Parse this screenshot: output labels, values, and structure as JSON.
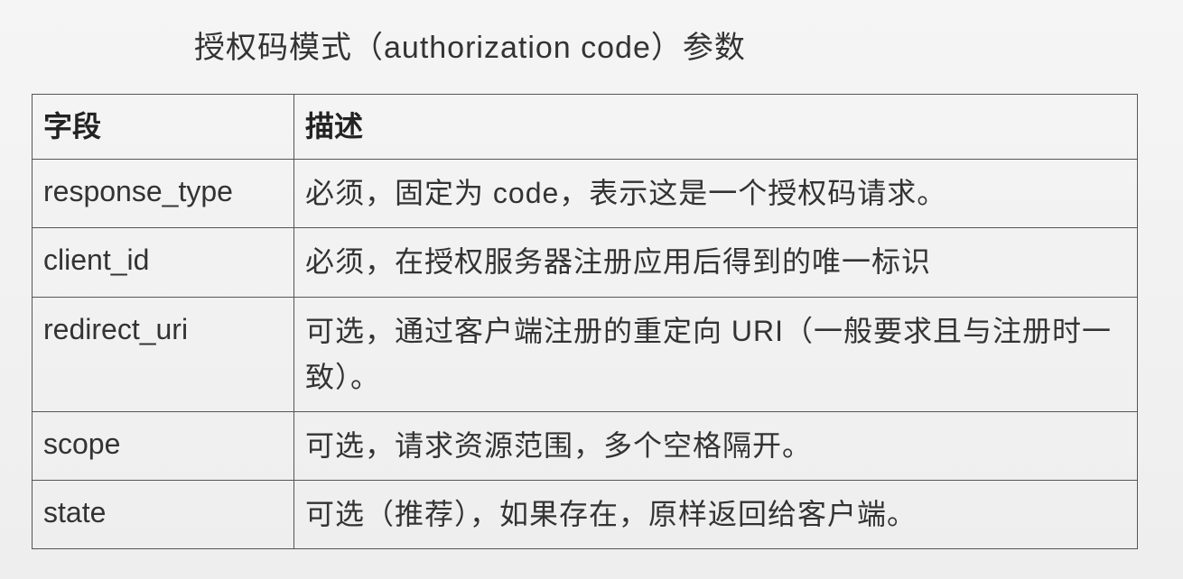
{
  "title": "授权码模式（authorization code）参数",
  "table": {
    "headers": {
      "field": "字段",
      "description": "描述"
    },
    "rows": [
      {
        "field": "response_type",
        "description": "必须，固定为 code，表示这是一个授权码请求。"
      },
      {
        "field": "client_id",
        "description": "必须，在授权服务器注册应用后得到的唯一标识"
      },
      {
        "field": "redirect_uri",
        "description": "可选，通过客户端注册的重定向 URI（一般要求且与注册时一致）。"
      },
      {
        "field": "scope",
        "description": "可选，请求资源范围，多个空格隔开。"
      },
      {
        "field": "state",
        "description": "可选（推荐），如果存在，原样返回给客户端。"
      }
    ]
  }
}
